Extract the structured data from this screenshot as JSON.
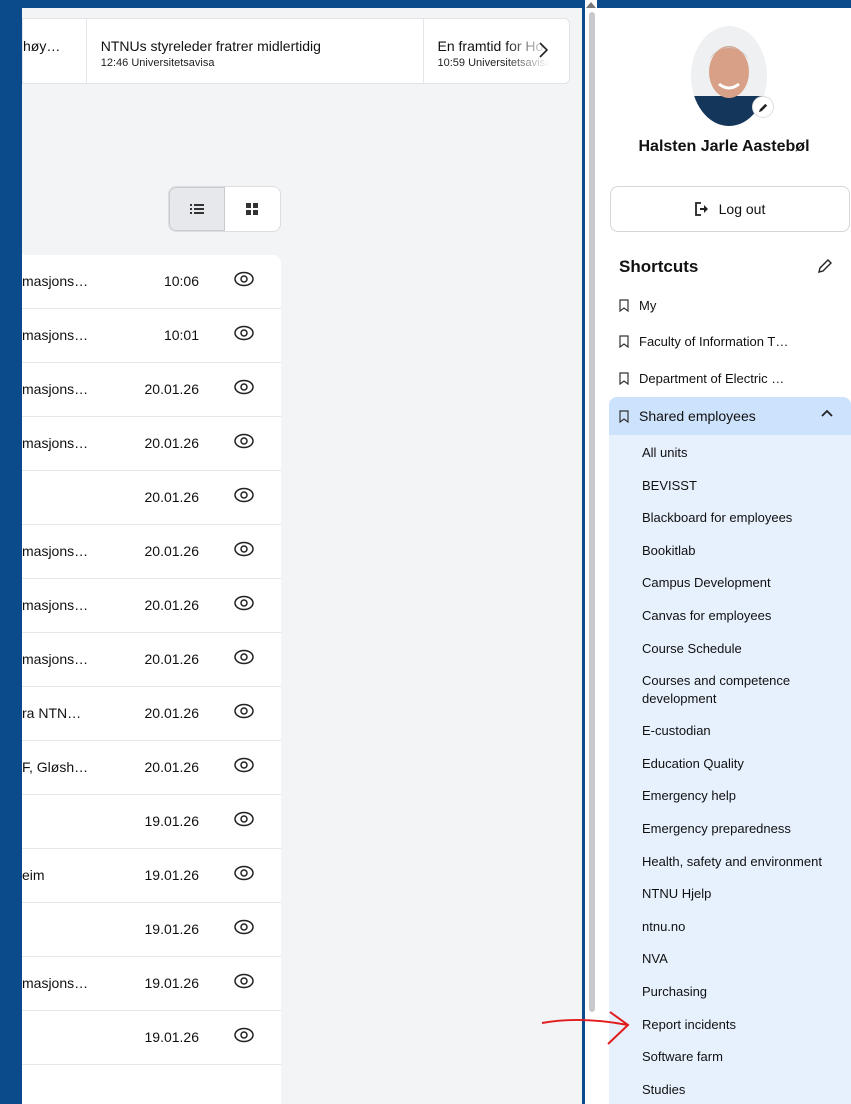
{
  "news": [
    {
      "title": "høy…",
      "sub": ""
    },
    {
      "title": "NTNUs styreleder fratrer midlertidig",
      "sub": "12:46 Universitetsavisa"
    },
    {
      "title": "En framtid for Ho",
      "sub": "10:59 Universitetsavisa"
    }
  ],
  "list_rows": [
    {
      "text": "masjons…",
      "time": "10:06"
    },
    {
      "text": "masjons…",
      "time": "10:01"
    },
    {
      "text": "masjons…",
      "time": "20.01.26"
    },
    {
      "text": "masjons…",
      "time": "20.01.26"
    },
    {
      "text": "",
      "time": "20.01.26"
    },
    {
      "text": "masjons…",
      "time": "20.01.26"
    },
    {
      "text": "masjons…",
      "time": "20.01.26"
    },
    {
      "text": "masjons…",
      "time": "20.01.26"
    },
    {
      "text": "ra NTN…",
      "time": "20.01.26"
    },
    {
      "text": "F, Gløsh…",
      "time": "20.01.26"
    },
    {
      "text": "",
      "time": "19.01.26"
    },
    {
      "text": "eim",
      "time": "19.01.26"
    },
    {
      "text": "",
      "time": "19.01.26"
    },
    {
      "text": "masjons…",
      "time": "19.01.26"
    },
    {
      "text": "",
      "time": "19.01.26"
    }
  ],
  "profile": {
    "name": "Halsten Jarle Aastebøl",
    "logout": "Log out"
  },
  "shortcuts": {
    "title": "Shortcuts",
    "items": [
      "My",
      "Faculty of Information T…",
      "Department of Electric …"
    ],
    "shared_label": "Shared employees",
    "shared_items": [
      "All units",
      "BEVISST",
      "Blackboard for employees",
      "Bookitlab",
      "Campus Development",
      "Canvas for employees",
      "Course Schedule",
      "Courses and competence development",
      "E-custodian",
      "Education Quality",
      "Emergency help",
      "Emergency preparedness",
      "Health, safety and environment",
      "NTNU Hjelp",
      "ntnu.no",
      "NVA",
      "Purchasing",
      "Report incidents",
      "Software farm",
      "Studies"
    ]
  },
  "colors": {
    "brand_blue": "#0b4a8b",
    "shared_bg": "#e7f1fe",
    "shared_head": "#cde2fc",
    "annotation_red": "#e11b1b"
  }
}
